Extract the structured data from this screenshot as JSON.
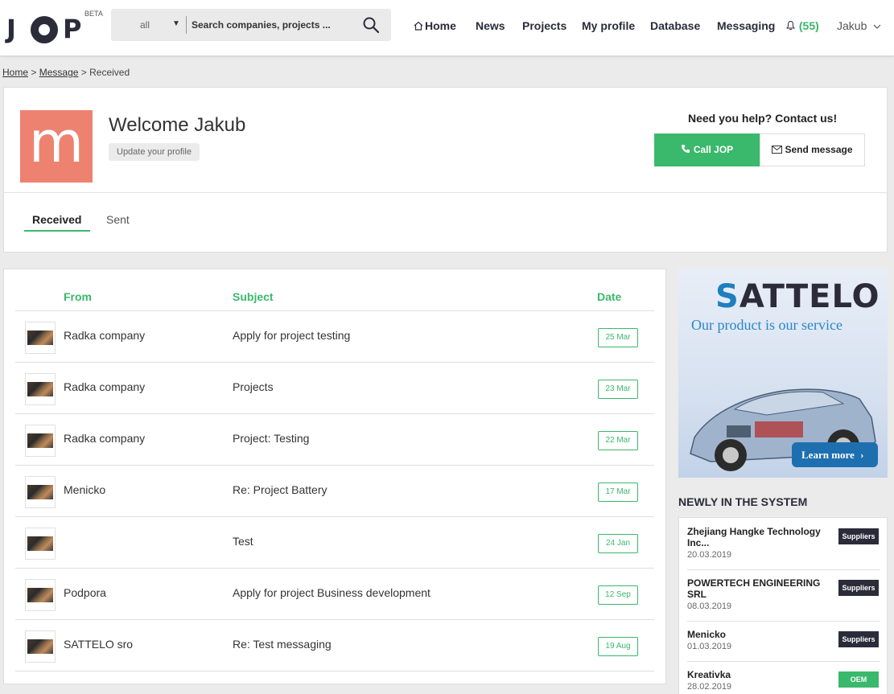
{
  "header": {
    "logo_text_j": "J",
    "logo_text_p": "P",
    "beta": "BETA",
    "search_scope": "all",
    "search_placeholder": "Search companies, projects ...",
    "nav": {
      "home": "Home",
      "news": "News",
      "projects": "Projects",
      "my_profile": "My profile",
      "database": "Database",
      "messaging": "Messaging",
      "notifications": "(55)",
      "user": "Jakub"
    }
  },
  "breadcrumb": {
    "home": "Home",
    "message": "Message",
    "current": "Received",
    "sep": ">"
  },
  "profile": {
    "avatar_letter": "m",
    "avatar_color": "#ee8270",
    "welcome": "Welcome Jakub",
    "update_button": "Update your profile",
    "help_text": "Need you help? Contact us!",
    "call_button": "Call JOP",
    "send_button": "Send message",
    "tabs": [
      "Received",
      "Sent"
    ]
  },
  "messages": {
    "columns": [
      "From",
      "Subject",
      "Date"
    ],
    "rows": [
      {
        "from": "Radka company",
        "subject": "Apply for project testing",
        "date": "25 Mar"
      },
      {
        "from": "Radka company",
        "subject": "Projects",
        "date": "23 Mar"
      },
      {
        "from": "Radka company",
        "subject": "Project: Testing",
        "date": "22 Mar"
      },
      {
        "from": "Menicko",
        "subject": "Re: Project Battery",
        "date": "17 Mar"
      },
      {
        "from": "",
        "subject": "Test",
        "date": "24 Jan"
      },
      {
        "from": "Podpora",
        "subject": "Apply for project Business development",
        "date": "12 Sep"
      },
      {
        "from": "SATTELO sro",
        "subject": "Re: Test messaging",
        "date": "19 Aug"
      }
    ]
  },
  "ad": {
    "brand_s": "S",
    "brand_rest": "ATTELO",
    "tagline": "Our product is our service",
    "cta": "Learn more"
  },
  "newly": {
    "title": "NEWLY IN THE SYSTEM",
    "items": [
      {
        "name": "Zhejiang Hangke Technology Inc...",
        "date": "20.03.2019",
        "badge": "Suppliers"
      },
      {
        "name": "POWERTECH ENGINEERING SRL",
        "date": "08.03.2019",
        "badge": "Suppliers"
      },
      {
        "name": "Menicko",
        "date": "01.03.2019",
        "badge": "Suppliers"
      },
      {
        "name": "Kreativka",
        "date": "28.02.2019",
        "badge": "OEM"
      }
    ]
  },
  "colors": {
    "accent": "#3ab86c",
    "dark": "#2b2b3a"
  }
}
